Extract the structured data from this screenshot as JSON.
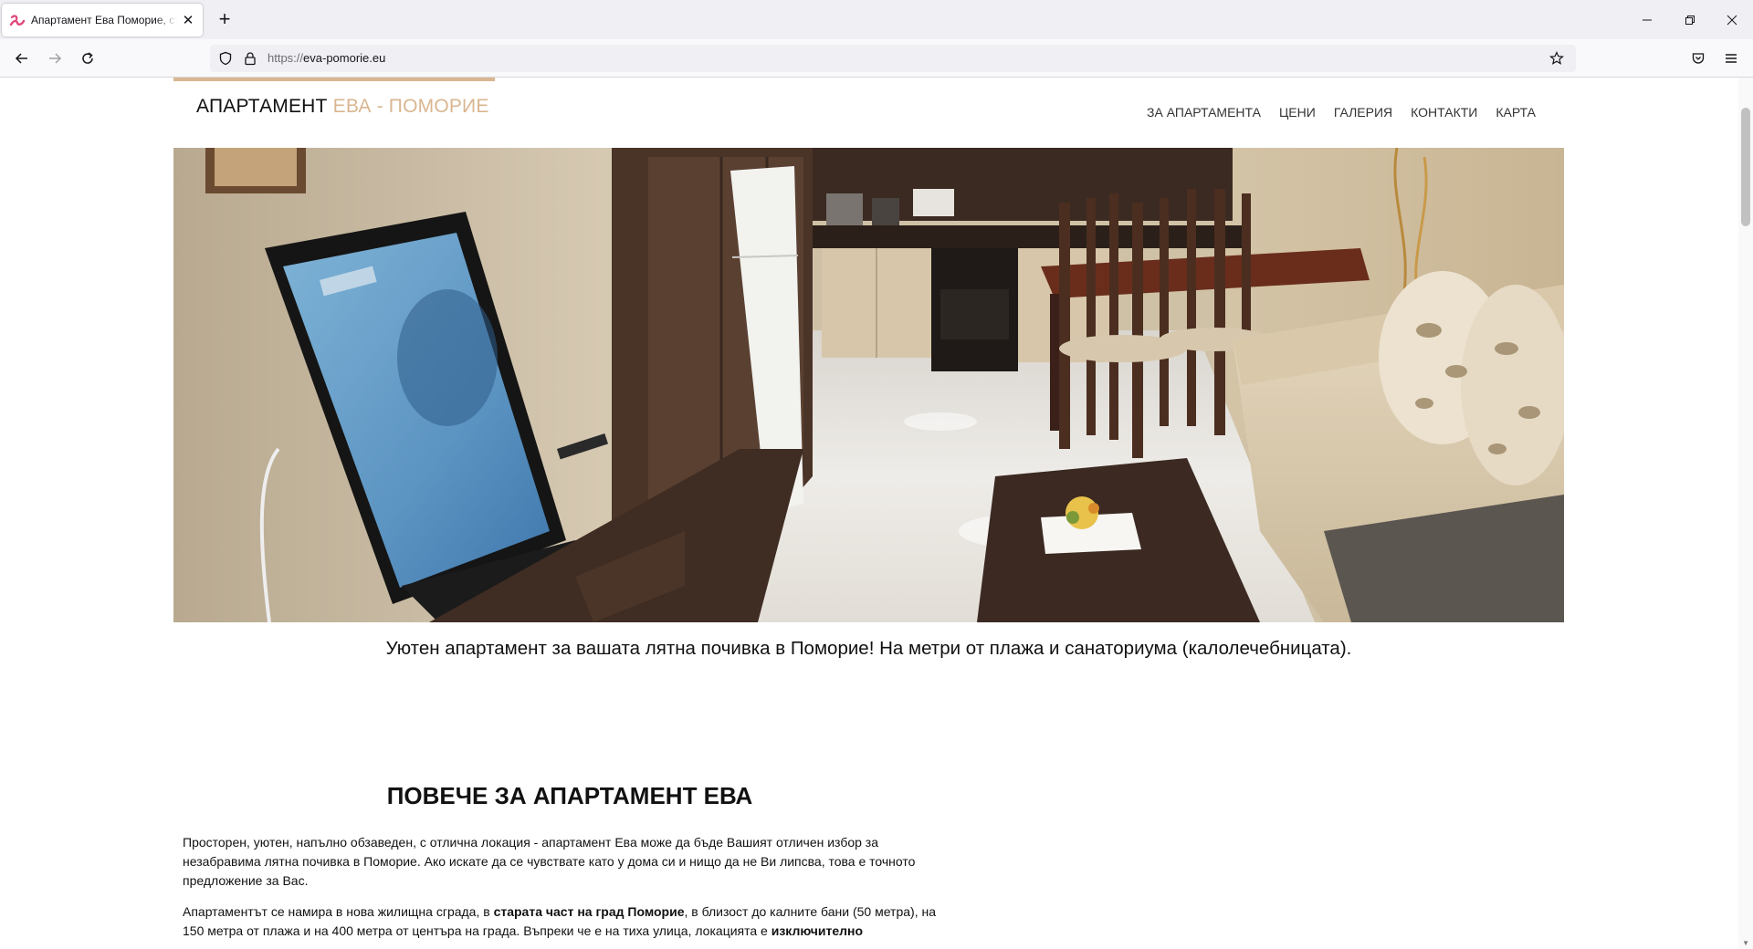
{
  "browser": {
    "tab_title": "Апартамент Ева Поморие, стар",
    "url_protocol": "https://",
    "url_host": "eva-pomorie.eu"
  },
  "site": {
    "logo_part1": "АПАРТАМЕНТ ",
    "logo_part2": "ЕВА - ПОМОРИЕ",
    "menu": [
      {
        "label": "ЗА АПАРТАМЕНТА"
      },
      {
        "label": "ЦЕНИ"
      },
      {
        "label": "ГАЛЕРИЯ"
      },
      {
        "label": "КОНТАКТИ"
      },
      {
        "label": "КАРТА"
      }
    ],
    "tagline": "Уютен апартамент за вашата лятна почивка в Поморие! На метри от плажа и санаториума (калолечебницата).",
    "section_title": "ПОВЕЧЕ ЗА АПАРТАМЕНТ ЕВА",
    "paragraph1": "Просторен, уютен, напълно обзаведен, с отлична локация - апартамент Ева може да бъде Вашият отличен избор за незабравима лятна почивка в Поморие. Ако искате да се чувствате като у дома си и нищо да не Ви липсва, това е точното предложение за Вас.",
    "paragraph2_a": "Апартаментът се намира в нова жилищна сграда, в ",
    "paragraph2_b": "старата част на град Поморие",
    "paragraph2_c": ", в близост до калните бани (50 метра), на 150 метра от плажа и на 400 метра от центъра на града. Въпреки че е на тиха улица, локацията е ",
    "paragraph2_d": "изключително"
  },
  "colors": {
    "accent": "#d9b690",
    "text": "#111111"
  }
}
